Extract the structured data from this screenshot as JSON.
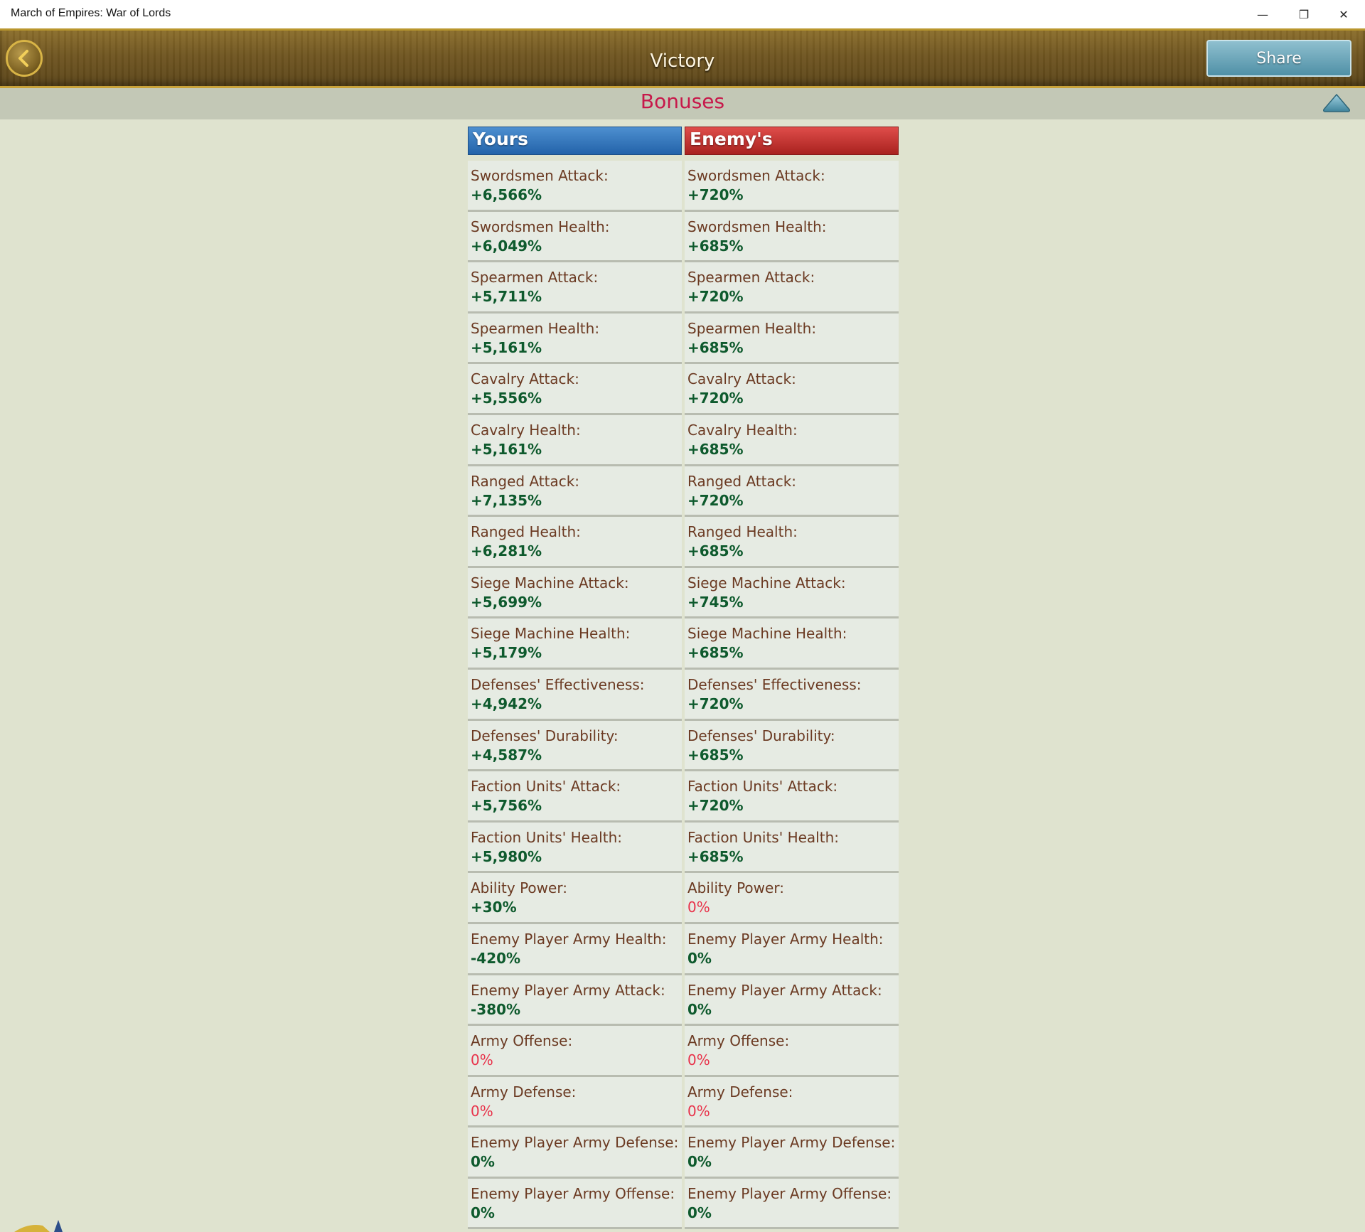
{
  "window": {
    "title": "March of Empires: War of Lords",
    "minimize": "—",
    "restore": "❐",
    "close": "✕"
  },
  "header": {
    "title": "Victory",
    "share_label": "Share"
  },
  "section": {
    "title": "Bonuses"
  },
  "columns": {
    "yours": "Yours",
    "enemy": "Enemy's"
  },
  "rows": [
    {
      "label": "Swordsmen Attack:",
      "yours": "+6,566%",
      "yours_kind": "pos",
      "enemy": "+720%",
      "enemy_kind": "pos"
    },
    {
      "label": "Swordsmen Health:",
      "yours": "+6,049%",
      "yours_kind": "pos",
      "enemy": "+685%",
      "enemy_kind": "pos"
    },
    {
      "label": "Spearmen Attack:",
      "yours": "+5,711%",
      "yours_kind": "pos",
      "enemy": "+720%",
      "enemy_kind": "pos"
    },
    {
      "label": "Spearmen Health:",
      "yours": "+5,161%",
      "yours_kind": "pos",
      "enemy": "+685%",
      "enemy_kind": "pos"
    },
    {
      "label": "Cavalry Attack:",
      "yours": "+5,556%",
      "yours_kind": "pos",
      "enemy": "+720%",
      "enemy_kind": "pos"
    },
    {
      "label": "Cavalry Health:",
      "yours": "+5,161%",
      "yours_kind": "pos",
      "enemy": "+685%",
      "enemy_kind": "pos"
    },
    {
      "label": "Ranged Attack:",
      "yours": "+7,135%",
      "yours_kind": "pos",
      "enemy": "+720%",
      "enemy_kind": "pos"
    },
    {
      "label": "Ranged Health:",
      "yours": "+6,281%",
      "yours_kind": "pos",
      "enemy": "+685%",
      "enemy_kind": "pos"
    },
    {
      "label": "Siege Machine Attack:",
      "yours": "+5,699%",
      "yours_kind": "pos",
      "enemy": "+745%",
      "enemy_kind": "pos"
    },
    {
      "label": "Siege Machine Health:",
      "yours": "+5,179%",
      "yours_kind": "pos",
      "enemy": "+685%",
      "enemy_kind": "pos"
    },
    {
      "label": "Defenses' Effectiveness:",
      "yours": "+4,942%",
      "yours_kind": "pos",
      "enemy": "+720%",
      "enemy_kind": "pos"
    },
    {
      "label": "Defenses' Durability:",
      "yours": "+4,587%",
      "yours_kind": "pos",
      "enemy": "+685%",
      "enemy_kind": "pos"
    },
    {
      "label": "Faction Units' Attack:",
      "yours": "+5,756%",
      "yours_kind": "pos",
      "enemy": "+720%",
      "enemy_kind": "pos"
    },
    {
      "label": "Faction Units' Health:",
      "yours": "+5,980%",
      "yours_kind": "pos",
      "enemy": "+685%",
      "enemy_kind": "pos"
    },
    {
      "label": "Ability Power:",
      "yours": "+30%",
      "yours_kind": "pos",
      "enemy": "0%",
      "enemy_kind": "zero"
    },
    {
      "label": "Enemy Player Army Health:",
      "yours": "-420%",
      "yours_kind": "pos",
      "enemy": "0%",
      "enemy_kind": "neutral"
    },
    {
      "label": "Enemy Player Army Attack:",
      "yours": "-380%",
      "yours_kind": "pos",
      "enemy": "0%",
      "enemy_kind": "neutral"
    },
    {
      "label": "Army Offense:",
      "yours": "0%",
      "yours_kind": "zero",
      "enemy": "0%",
      "enemy_kind": "zero"
    },
    {
      "label": "Army Defense:",
      "yours": "0%",
      "yours_kind": "zero",
      "enemy": "0%",
      "enemy_kind": "zero"
    },
    {
      "label": "Enemy Player Army Defense:",
      "yours": "0%",
      "yours_kind": "neutral",
      "enemy": "0%",
      "enemy_kind": "neutral"
    },
    {
      "label": "Enemy Player Army Offense:",
      "yours": "0%",
      "yours_kind": "neutral",
      "enemy": "0%",
      "enemy_kind": "neutral"
    }
  ],
  "colors": {
    "positive": "#0e5a2d",
    "zero": "#e8324a",
    "label": "#6b3a22",
    "yours_header": "#2363a9",
    "enemy_header": "#a9221f",
    "section_title": "#c7184a"
  },
  "icons": {
    "back": "chevron-left-icon",
    "collapse": "triangle-up-icon"
  }
}
